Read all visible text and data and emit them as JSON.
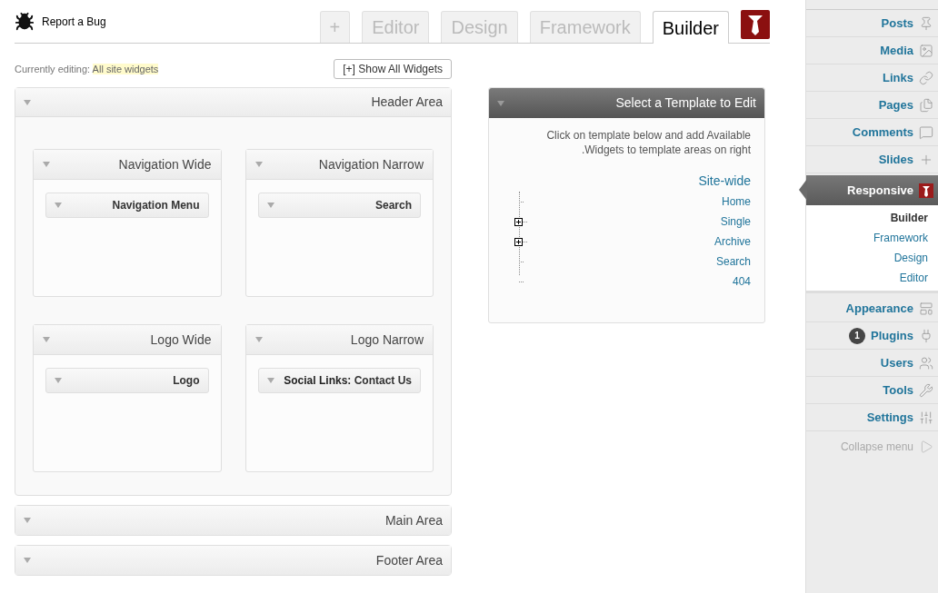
{
  "header": {
    "report_link": "Report a Bug"
  },
  "tabs": [
    {
      "label": "+",
      "selected": false
    },
    {
      "label": "Editor",
      "selected": false
    },
    {
      "label": "Design",
      "selected": false
    },
    {
      "label": "Framework",
      "selected": false
    },
    {
      "label": "Builder",
      "selected": true
    }
  ],
  "editing": {
    "label": "Currently editing:",
    "value": "All site widgets"
  },
  "show_all_button": "[+] Show All Widgets",
  "areas": [
    {
      "title": "Header Area",
      "expanded": true,
      "sidebars": [
        {
          "title": "Navigation Wide",
          "widgets": [
            "Navigation Menu"
          ]
        },
        {
          "title": "Navigation Narrow",
          "widgets": [
            "Search"
          ]
        },
        {
          "title": "Logo Wide",
          "widgets": [
            "Logo"
          ]
        },
        {
          "title": "Logo Narrow",
          "widgets": [
            "**Social Links:** Contact Us"
          ]
        }
      ]
    },
    {
      "title": "Main Area",
      "expanded": false
    },
    {
      "title": "Footer Area",
      "expanded": false
    }
  ],
  "template_panel": {
    "title": "Select a Template to Edit",
    "instructions": "Click on template below and add Available .Widgets to template areas on right",
    "tree": {
      "label": "Site-wide",
      "children": [
        {
          "label": "Home",
          "kind": "leaf"
        },
        {
          "label": "Single",
          "kind": "expandable"
        },
        {
          "label": "Archive",
          "kind": "expandable"
        },
        {
          "label": "Search",
          "kind": "leaf"
        },
        {
          "label": "404",
          "kind": "leaf"
        }
      ]
    }
  },
  "admin_menu": [
    {
      "label": "Posts",
      "selected": false
    },
    {
      "label": "Media",
      "selected": false
    },
    {
      "label": "Links",
      "selected": false
    },
    {
      "label": "Pages",
      "selected": false
    },
    {
      "label": "Comments",
      "selected": false
    },
    {
      "label": "Slides",
      "selected": false
    },
    {
      "label": "Responsive",
      "selected": true,
      "submenu": [
        {
          "label": "Builder",
          "selected": true
        },
        {
          "label": "Framework",
          "selected": false
        },
        {
          "label": "Design",
          "selected": false
        },
        {
          "label": "Editor",
          "selected": false
        }
      ]
    },
    {
      "label": "Appearance",
      "selected": false
    },
    {
      "label": "Plugins",
      "selected": false,
      "badge": "1"
    },
    {
      "label": "Users",
      "selected": false
    },
    {
      "label": "Tools",
      "selected": false
    },
    {
      "label": "Settings",
      "selected": false
    }
  ],
  "collapse_menu": "Collapse menu"
}
